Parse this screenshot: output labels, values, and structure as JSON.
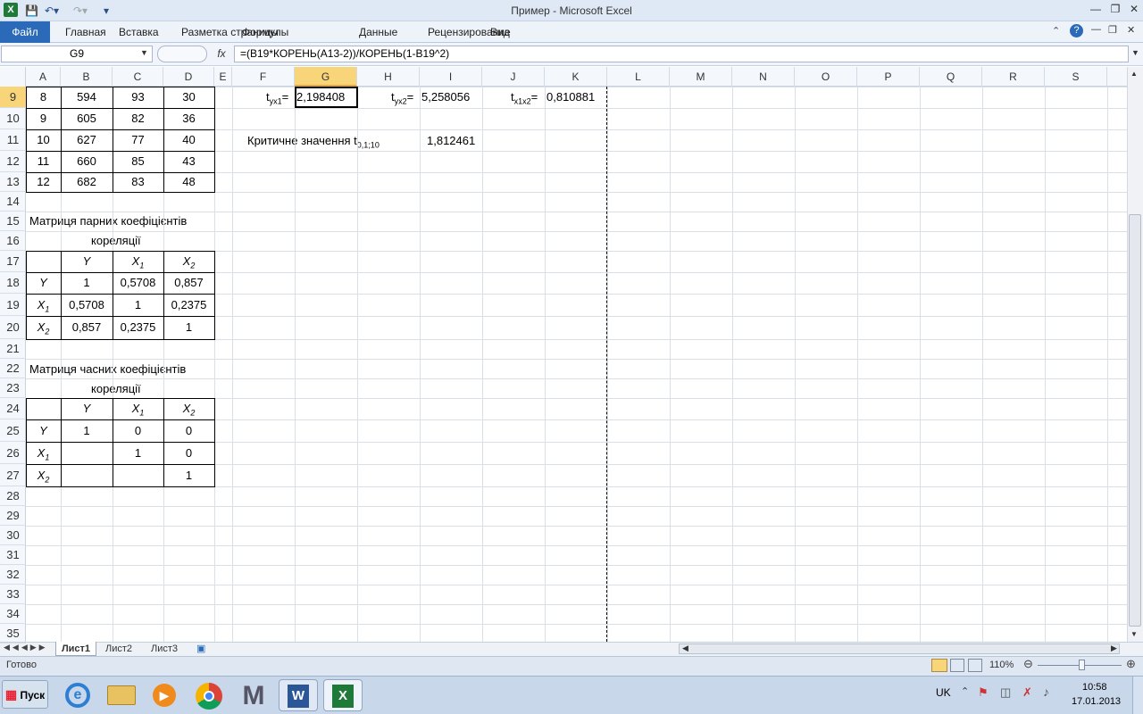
{
  "window": {
    "title": "Пример  -  Microsoft Excel"
  },
  "ribbon": {
    "tabs": [
      "Файл",
      "Главная",
      "Вставка",
      "Разметка страницы",
      "Формулы",
      "Данные",
      "Рецензирование",
      "Вид"
    ]
  },
  "formula_bar": {
    "name_box": "G9",
    "fx": "fx",
    "formula": "=(B19*КОРЕНЬ(A13-2))/КОРЕНЬ(1-B19^2)"
  },
  "columns": [
    "A",
    "B",
    "C",
    "D",
    "E",
    "F",
    "G",
    "H",
    "I",
    "J",
    "K",
    "L",
    "M",
    "N",
    "O",
    "P",
    "Q",
    "R",
    "S"
  ],
  "rows": [
    "9",
    "10",
    "11",
    "12",
    "13",
    "14",
    "15",
    "16",
    "17",
    "18",
    "19",
    "20",
    "21",
    "22",
    "23",
    "24",
    "25",
    "26",
    "27",
    "28",
    "29",
    "30",
    "31",
    "32",
    "33",
    "34",
    "35"
  ],
  "data_rows": [
    [
      "8",
      "594",
      "93",
      "30"
    ],
    [
      "9",
      "605",
      "82",
      "36"
    ],
    [
      "10",
      "627",
      "77",
      "40"
    ],
    [
      "11",
      "660",
      "85",
      "43"
    ],
    [
      "12",
      "682",
      "83",
      "48"
    ]
  ],
  "tstat": {
    "t1": {
      "label": "t",
      "sub": "yx1",
      "eq": "=",
      "value": "2,198408"
    },
    "t2": {
      "label": "t",
      "sub": "yx2",
      "eq": "=",
      "value": "5,258056"
    },
    "t3": {
      "label": "t",
      "sub": "x1x2",
      "eq": "=",
      "value": "0,810881"
    },
    "crit": {
      "label": "Критичне значення t",
      "sub": "0,1;10",
      "value": "1,812461"
    }
  },
  "matrix1": {
    "title1": "Матриця парних коефіцієнтів",
    "title2": "кореляції",
    "headers": [
      "Y",
      "X",
      "1",
      "X",
      "2"
    ],
    "rows": [
      [
        "Y",
        "1",
        "0,5708",
        "0,857"
      ],
      [
        "X",
        "0,5708",
        "1",
        "0,2375"
      ],
      [
        "X",
        "0,857",
        "0,2375",
        "1"
      ]
    ],
    "row_subs": [
      "",
      "1",
      "2"
    ]
  },
  "matrix2": {
    "title1": "Матриця часних коефіцієнтів",
    "title2": "кореляції",
    "headers": [
      "Y",
      "X",
      "1",
      "X",
      "2"
    ],
    "rows": [
      [
        "Y",
        "1",
        "0",
        "0"
      ],
      [
        "X",
        "",
        "1",
        "0"
      ],
      [
        "X",
        "",
        "",
        "1"
      ]
    ],
    "row_subs": [
      "",
      "1",
      "2"
    ]
  },
  "sheets": [
    "Лист1",
    "Лист2",
    "Лист3"
  ],
  "status": {
    "ready": "Готово",
    "zoom": "110%"
  },
  "taskbar": {
    "start": "Пуск",
    "lang": "UK",
    "time": "10:58",
    "date": "17.01.2013"
  },
  "colors": {
    "file_tab": "#2a6ab8",
    "selection": "#f9d57a",
    "excel_green": "#1f7a3a"
  }
}
